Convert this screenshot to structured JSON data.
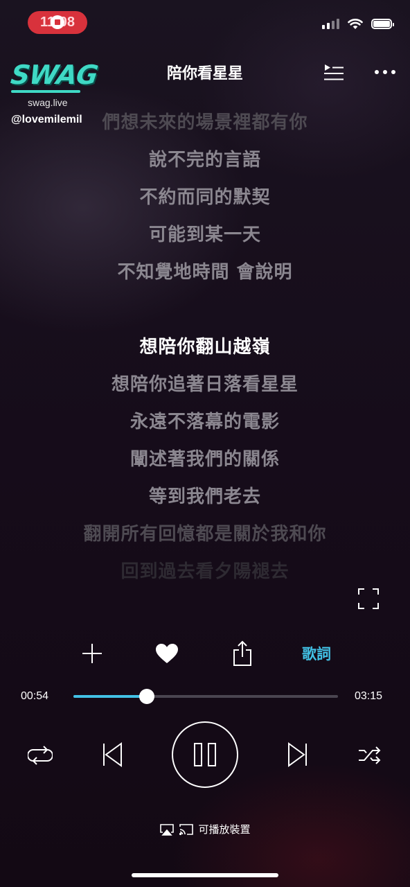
{
  "status_bar": {
    "time": "11:08",
    "icons": [
      "screen-record-icon",
      "cellular-signal-icon",
      "wifi-icon",
      "battery-icon"
    ]
  },
  "watermark": {
    "brand": "SWAG",
    "url": "swag.live",
    "handle": "@lovemilemil"
  },
  "header": {
    "title": "陪你看星星",
    "icons": [
      "queue-icon",
      "more-icon"
    ]
  },
  "lyrics": {
    "lines": [
      "們想未來的場景裡都有你",
      "說不完的言語",
      "不約而同的默契",
      "可能到某一天",
      "不知覺地時間 會說明",
      "",
      "想陪你翻山越嶺",
      "想陪你追著日落看星星",
      "永遠不落幕的電影",
      "闡述著我們的關係",
      "等到我們老去",
      "翻開所有回憶都是關於我和你",
      "回到過去看夕陽褪去"
    ],
    "current_index": 6
  },
  "actions": {
    "add_icon": "plus-icon",
    "like_icon": "heart-icon",
    "share_icon": "share-icon",
    "lyrics_label": "歌詞"
  },
  "progress": {
    "elapsed": "00:54",
    "total": "03:15",
    "fraction": 0.277
  },
  "controls": {
    "icons": [
      "repeat-icon",
      "previous-icon",
      "pause-icon",
      "next-icon",
      "shuffle-icon"
    ]
  },
  "cast": {
    "label": "可播放裝置"
  },
  "colors": {
    "accent": "#42c1e5",
    "record": "#d8323c",
    "brand": "#3fd9c5"
  }
}
